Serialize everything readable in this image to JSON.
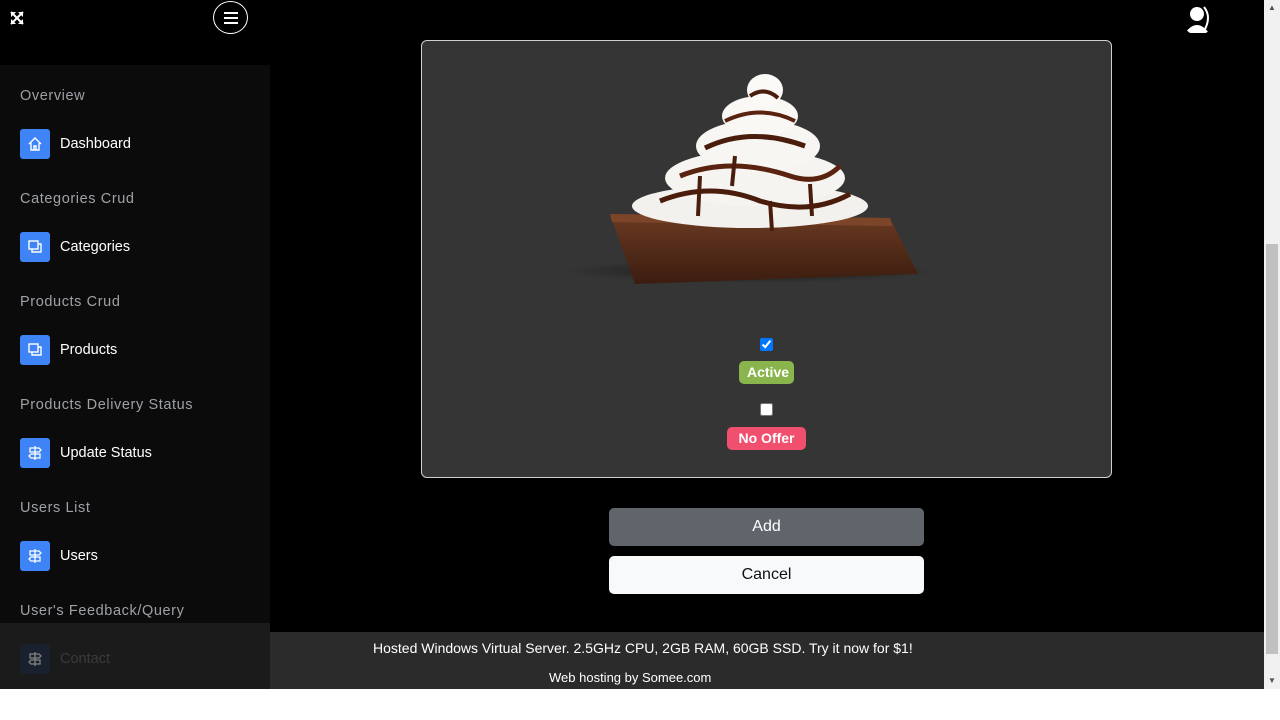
{
  "topbar": {
    "expand_icon": "expand-arrows-icon",
    "menu_icon": "hamburger-menu-icon",
    "avatar_icon": "user-avatar-icon"
  },
  "sidebar": {
    "sections": [
      {
        "title": "Overview",
        "item": {
          "label": "Dashboard",
          "icon": "home-icon"
        }
      },
      {
        "title": "Categories Crud",
        "item": {
          "label": "Categories",
          "icon": "copy-icon"
        }
      },
      {
        "title": "Products Crud",
        "item": {
          "label": "Products",
          "icon": "copy-icon"
        }
      },
      {
        "title": "Products Delivery Status",
        "item": {
          "label": "Update Status",
          "icon": "signpost-icon"
        }
      },
      {
        "title": "Users List",
        "item": {
          "label": "Users",
          "icon": "signpost-icon"
        }
      },
      {
        "title": "User's Feedback/Query",
        "item": {
          "label": "Contact",
          "icon": "signpost-icon"
        }
      }
    ]
  },
  "form": {
    "active_checked": true,
    "active_label": "Active",
    "offer_checked": false,
    "offer_label": "No Offer",
    "add_label": "Add",
    "cancel_label": "Cancel"
  },
  "hosting_ad": {
    "line1": "Hosted Windows Virtual Server. 2.5GHz CPU, 2GB RAM, 60GB SSD. Try it now for $1!",
    "line2": "Web hosting by Somee.com"
  },
  "colors": {
    "accent_blue": "#3e84f6",
    "active_badge": "#8ab54d",
    "offer_badge": "#f0506e",
    "add_button": "#60656b"
  }
}
